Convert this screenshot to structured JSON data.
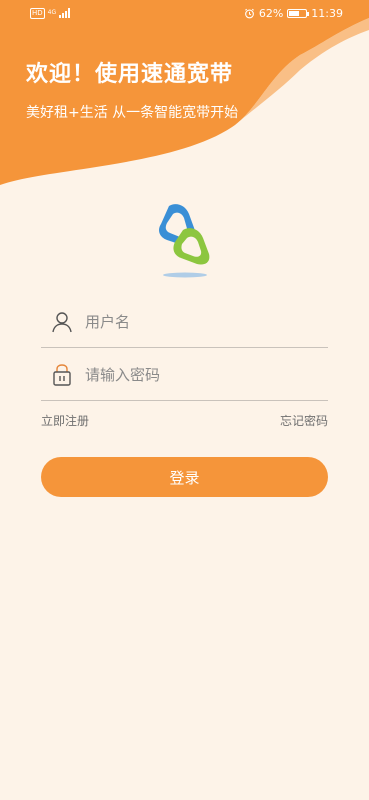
{
  "status_bar": {
    "hd": "HD",
    "network": "4G",
    "battery": "62%",
    "battery_level": 0.62,
    "time": "11:39",
    "alarm_icon": "alarm-clock-icon"
  },
  "header": {
    "title": "欢迎！使用速通宽带",
    "subtitle": "美好租+生活 从一条智能宽带开始"
  },
  "colors": {
    "primary": "#f5953a",
    "background": "#fdf3e8",
    "logo_blue": "#3a8fd6",
    "logo_green": "#8cc63f"
  },
  "form": {
    "username_placeholder": "用户名",
    "username_icon": "user-icon",
    "password_placeholder": "请输入密码",
    "password_icon": "lock-icon"
  },
  "links": {
    "register": "立即注册",
    "forgot": "忘记密码"
  },
  "login_button": "登录"
}
